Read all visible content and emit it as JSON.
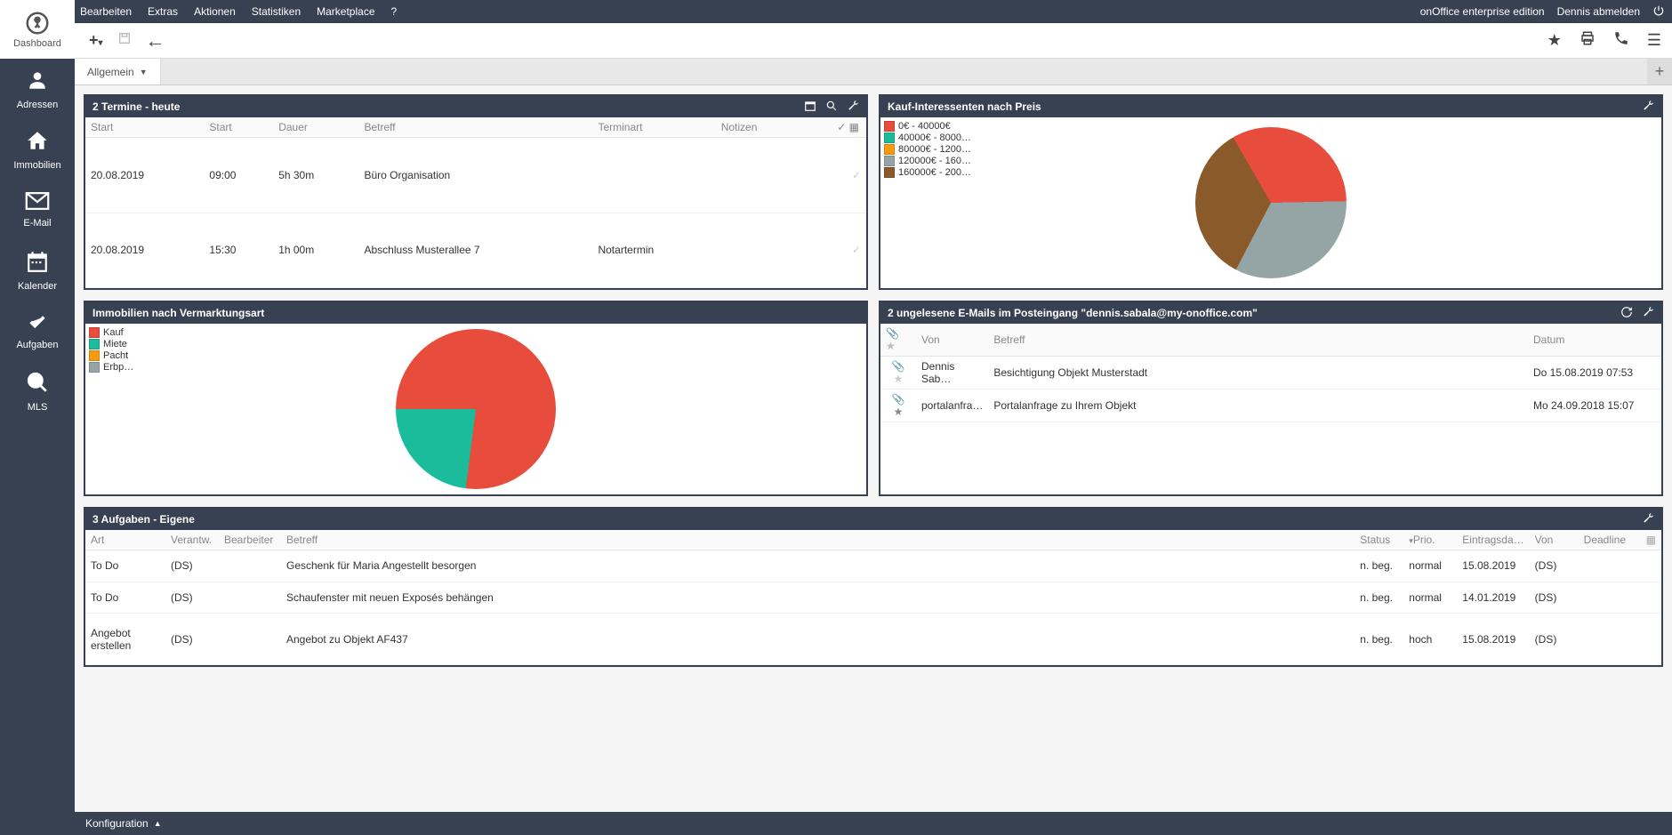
{
  "topmenu": {
    "items": [
      "Bearbeiten",
      "Extras",
      "Aktionen",
      "Statistiken",
      "Marketplace",
      "?"
    ],
    "edition": "onOffice enterprise edition",
    "logout": "Dennis abmelden"
  },
  "sidebar": {
    "top_label": "Dashboard",
    "items": [
      {
        "label": "Adressen",
        "icon": "person"
      },
      {
        "label": "Immobilien",
        "icon": "home"
      },
      {
        "label": "E-Mail",
        "icon": "mail"
      },
      {
        "label": "Kalender",
        "icon": "calendar"
      },
      {
        "label": "Aufgaben",
        "icon": "check"
      },
      {
        "label": "MLS",
        "icon": "search"
      }
    ]
  },
  "tabs": {
    "active": "Allgemein"
  },
  "termine": {
    "title": "2 Termine - heute",
    "cols": [
      "Start",
      "Start",
      "Dauer",
      "Betreff",
      "Terminart",
      "Notizen"
    ],
    "rows": [
      {
        "date": "20.08.2019",
        "time": "09:00",
        "dur": "5h 30m",
        "betreff": "Büro Organisation",
        "art": "",
        "not": ""
      },
      {
        "date": "20.08.2019",
        "time": "15:30",
        "dur": "1h 00m",
        "betreff": "Abschluss Musterallee 7",
        "art": "Notartermin",
        "not": ""
      }
    ]
  },
  "kauf": {
    "title": "Kauf-Interessenten nach Preis",
    "legend": [
      {
        "label": "0€ - 40000€",
        "color": "#e74c3c"
      },
      {
        "label": "40000€ - 8000…",
        "color": "#1abc9c"
      },
      {
        "label": "80000€ - 1200…",
        "color": "#f39c12"
      },
      {
        "label": "120000€ - 160…",
        "color": "#95a5a6"
      },
      {
        "label": "160000€ - 200…",
        "color": "#8b5a2b"
      }
    ]
  },
  "vermarktung": {
    "title": "Immobilien nach Vermarktungsart",
    "legend": [
      {
        "label": "Kauf",
        "color": "#e74c3c"
      },
      {
        "label": "Miete",
        "color": "#1abc9c"
      },
      {
        "label": "Pacht",
        "color": "#f39c12"
      },
      {
        "label": "Erbp…",
        "color": "#95a5a6"
      }
    ]
  },
  "emails": {
    "title": "2 ungelesene E-Mails im Posteingang \"dennis.sabala@my-onoffice.com\"",
    "cols": {
      "von": "Von",
      "betreff": "Betreff",
      "datum": "Datum"
    },
    "rows": [
      {
        "star": false,
        "von": "Dennis Sab…",
        "betreff": "Besichtigung Objekt Musterstadt",
        "datum": "Do 15.08.2019 07:53"
      },
      {
        "star": true,
        "von": "portalanfra…",
        "betreff": "Portalanfrage zu Ihrem Objekt",
        "datum": "Mo 24.09.2018 15:07"
      }
    ]
  },
  "aufgaben": {
    "title": "3 Aufgaben - Eigene",
    "cols": [
      "Art",
      "Verantw.",
      "Bearbeiter",
      "Betreff",
      "Status",
      "Prio.",
      "Eintragsda…",
      "Von",
      "Deadline"
    ],
    "rows": [
      {
        "art": "To Do",
        "ver": "(DS)",
        "bea": "",
        "bet": "Geschenk für Maria Angestellt besorgen",
        "sta": "n. beg.",
        "pri": "normal",
        "ein": "15.08.2019",
        "von": "(DS)",
        "dea": ""
      },
      {
        "art": "To Do",
        "ver": "(DS)",
        "bea": "",
        "bet": "Schaufenster mit neuen Exposés behängen",
        "sta": "n. beg.",
        "pri": "normal",
        "ein": "14.01.2019",
        "von": "(DS)",
        "dea": ""
      },
      {
        "art": "Angebot erstellen",
        "ver": "(DS)",
        "bea": "",
        "bet": "Angebot zu Objekt AF437",
        "sta": "n. beg.",
        "pri": "hoch",
        "ein": "15.08.2019",
        "von": "(DS)",
        "dea": ""
      }
    ]
  },
  "bottom": {
    "config": "Konfiguration"
  },
  "chart_data": [
    {
      "type": "pie",
      "title": "Kauf-Interessenten nach Preis",
      "series": [
        {
          "name": "0€ - 40000€",
          "value": 33,
          "color": "#e74c3c"
        },
        {
          "name": "120000€ - 160000€",
          "value": 33,
          "color": "#95a5a6"
        },
        {
          "name": "160000€ - 200000€",
          "value": 34,
          "color": "#8b5a2b"
        }
      ]
    },
    {
      "type": "pie",
      "title": "Immobilien nach Vermarktungsart",
      "series": [
        {
          "name": "Kauf",
          "value": 77,
          "color": "#e74c3c"
        },
        {
          "name": "Miete",
          "value": 23,
          "color": "#1abc9c"
        }
      ]
    }
  ]
}
